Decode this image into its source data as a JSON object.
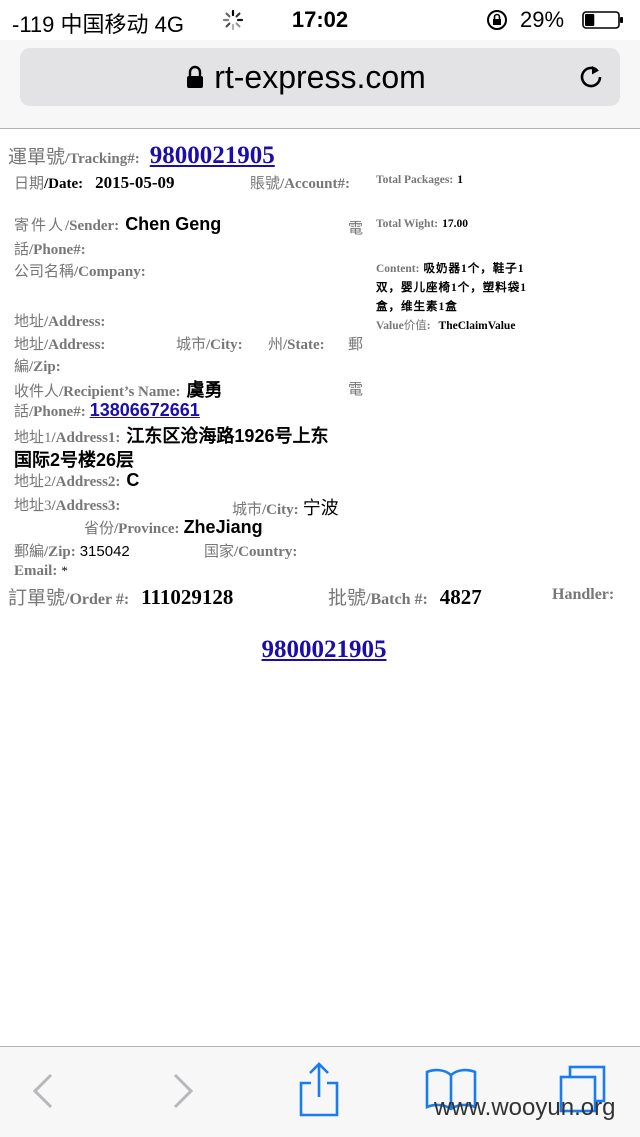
{
  "status_bar": {
    "carrier": "-119 中国移动  4G",
    "time": "17:02",
    "battery": "29%",
    "battery_level": 0.29,
    "icons": [
      "activity-spinner-icon",
      "orientation-lock-icon",
      "battery-icon"
    ]
  },
  "browser": {
    "url": "rt-express.com",
    "icons": [
      "padlock-icon",
      "reload-icon"
    ]
  },
  "tracking": {
    "label_zh": "運單號",
    "label_en": "/Tracking#",
    "colon": ":",
    "number": "9800021905"
  },
  "date": {
    "label_zh": "日期",
    "label_en": "/Date",
    "colon": ":",
    "value": "2015-05-09"
  },
  "account": {
    "label_zh": "賬號",
    "label_en": "/Account#:"
  },
  "sender": {
    "label_zh": "寄件人",
    "label_en": "/Sender:",
    "name": "Chen  Geng",
    "phone_zh_1": "電",
    "phone_zh_2": "話",
    "phone_en": "/Phone#:",
    "company_zh": "公司名稱",
    "company_en": "/Company:",
    "address_zh": "地址",
    "address_en": "/Address:",
    "address2_zh": "地址",
    "address2_en": "/Address:",
    "city_zh": "城市",
    "city_en": "/City:",
    "state_zh": "州",
    "state_en": "/State:",
    "zip_zh_1": "郵",
    "zip_zh_2": "編",
    "zip_en": "/Zip:"
  },
  "recipient": {
    "label_zh": "收件人",
    "label_en": "/Recipient’s Name:",
    "name": "虞勇",
    "phone_zh_1": "電",
    "phone_zh_2": "話",
    "phone_en": "/Phone#:",
    "phone": "13806672661",
    "address1_zh": "地址1",
    "address1_en": "/Address1:",
    "address1_line1": "江东区沧海路1926号上东",
    "address1_line2": "国际2号楼26层",
    "address2_zh": "地址2",
    "address2_en": "/Address2:",
    "address2_value": "C",
    "address3_zh": "地址3",
    "address3_en": "/Address3:",
    "city_zh": "城市",
    "city_en": "/City:",
    "city_value": "宁波",
    "province_zh": "省份",
    "province_en": "/Province:",
    "province_value": "ZheJiang",
    "zip_zh": "郵編",
    "zip_en": "/Zip:",
    "zip_value": "315042",
    "country_zh": "国家",
    "country_en": "/Country:",
    "email_en": "Email:",
    "email_value": "*"
  },
  "packages": {
    "total_packages_label": "Total Packages",
    "total_packages_colon": ":",
    "total_packages_value": "1",
    "total_weight_label": "Total Wight",
    "total_weight_colon": ":",
    "total_weight_value": "17.00",
    "content_label": "Content:",
    "content_line1": "吸奶器1个，鞋子1",
    "content_line2": "双，婴儿座椅1个，塑料袋1",
    "content_line3": "盒，维生素1盒",
    "value_label_en": "Value",
    "value_label_zh": "价值",
    "value_colon": ":",
    "value_value": "TheClaimValue"
  },
  "order": {
    "order_zh": "訂單號",
    "order_en": "/Order #",
    "order_colon": ":",
    "order_value": "111029128",
    "batch_zh": "批號",
    "batch_en": "/Batch #",
    "batch_colon": ":",
    "batch_value": "4827",
    "handler_label": "Handler",
    "handler_colon": ":"
  },
  "barcode_link": "9800021905",
  "toolbar": {
    "icons": [
      "back-icon",
      "forward-icon",
      "share-icon",
      "bookmarks-icon",
      "tabs-icon"
    ]
  },
  "watermark": "www.wooyun.org",
  "colors": {
    "link": "#1a0dab",
    "label": "#777777",
    "value": "#000000",
    "ios_blue": "#1a7cf5"
  }
}
